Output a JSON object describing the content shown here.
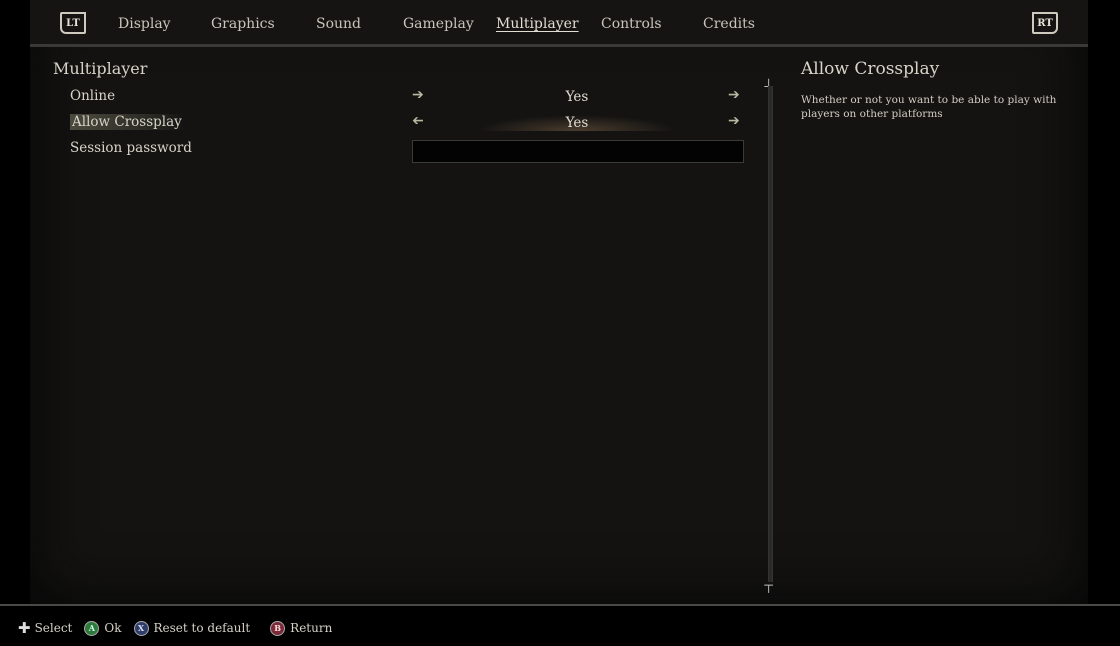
{
  "tabbar": {
    "left_trigger": "LT",
    "right_trigger": "RT",
    "tabs": [
      {
        "label": "Display"
      },
      {
        "label": "Graphics"
      },
      {
        "label": "Sound"
      },
      {
        "label": "Gameplay"
      },
      {
        "label": "Multiplayer",
        "active": true
      },
      {
        "label": "Controls"
      },
      {
        "label": "Credits"
      }
    ]
  },
  "section": {
    "title": "Multiplayer",
    "rows": [
      {
        "label": "Online",
        "value": "Yes"
      },
      {
        "label": "Allow Crossplay",
        "value": "Yes",
        "selected": true
      },
      {
        "label": "Session password",
        "value": ""
      }
    ]
  },
  "description": {
    "title": "Allow Crossplay",
    "body": "Whether or not you want to be able to play with players on other platforms"
  },
  "footer": {
    "select": "Select",
    "ok": "Ok",
    "reset": "Reset to default",
    "return": "Return",
    "a_glyph": "A",
    "x_glyph": "X",
    "b_glyph": "B"
  },
  "colors": {
    "button_a": "#2f7a3a",
    "button_x": "#2e3d6a",
    "button_b": "#7a2a38"
  }
}
